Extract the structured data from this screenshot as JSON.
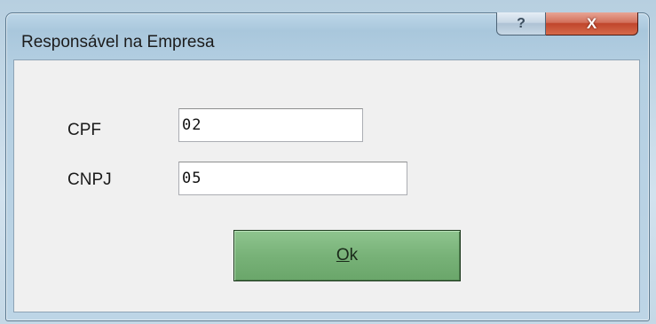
{
  "window": {
    "title": "Responsável na Empresa",
    "help_glyph": "?",
    "close_glyph": "X",
    "icons": {
      "help": "help-icon",
      "close": "close-icon"
    }
  },
  "form": {
    "cpf_label": "CPF",
    "cpf_value": "02",
    "cnpj_label": "CNPJ",
    "cnpj_value": "05"
  },
  "ok_button": {
    "mnemonic": "O",
    "rest": "k"
  },
  "colors": {
    "ok_button": "#78b278",
    "close_button": "#c0452c",
    "client_bg": "#f0f0f0"
  }
}
